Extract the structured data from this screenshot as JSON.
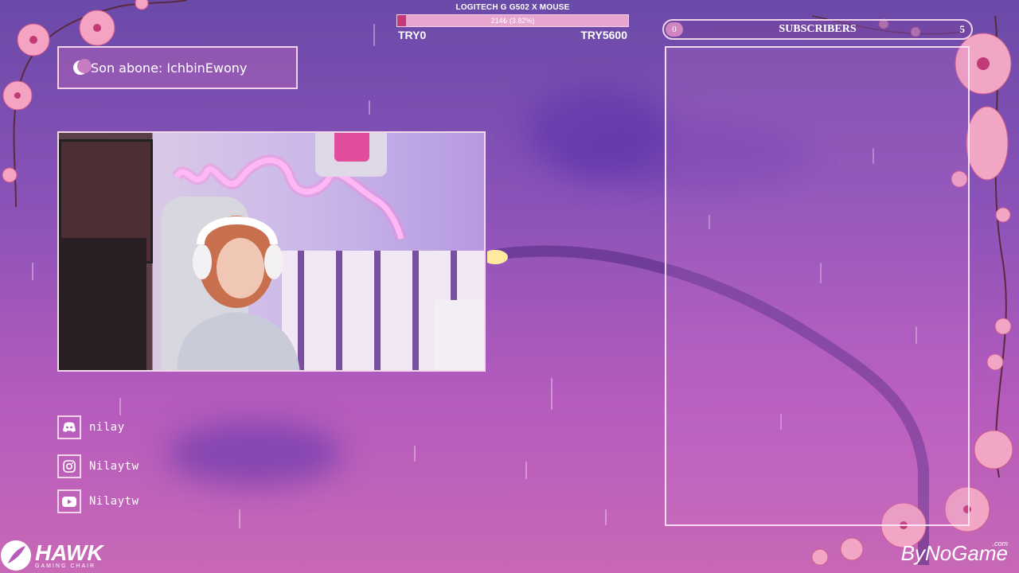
{
  "goal": {
    "title": "LOGITECH G G502 X MOUSE",
    "progress_text": "214₺ (3.82%)",
    "progress_fraction": 0.0382,
    "min_label": "TRY0",
    "max_label": "TRY5600"
  },
  "subscribers": {
    "count": "0",
    "label": "SUBSCRIBERS",
    "goal": "5"
  },
  "last_sub": {
    "text": "Son abone: IchbinEwony"
  },
  "socials": [
    {
      "platform": "discord",
      "handle": "nilay",
      "icon": "discord-icon"
    },
    {
      "platform": "instagram",
      "handle": "Nilaytw",
      "icon": "instagram-icon"
    },
    {
      "platform": "youtube",
      "handle": "Nilaytw",
      "icon": "youtube-icon"
    }
  ],
  "sponsors": {
    "hawk_name": "HAWK",
    "hawk_sub": "GAMING CHAIR",
    "bynogame": "ByNoGame",
    "bynogame_tld": ".com"
  },
  "colors": {
    "accent_pink": "#e14d9a",
    "frame": "#f3d3ea",
    "goal_fill": "#c23a78"
  }
}
